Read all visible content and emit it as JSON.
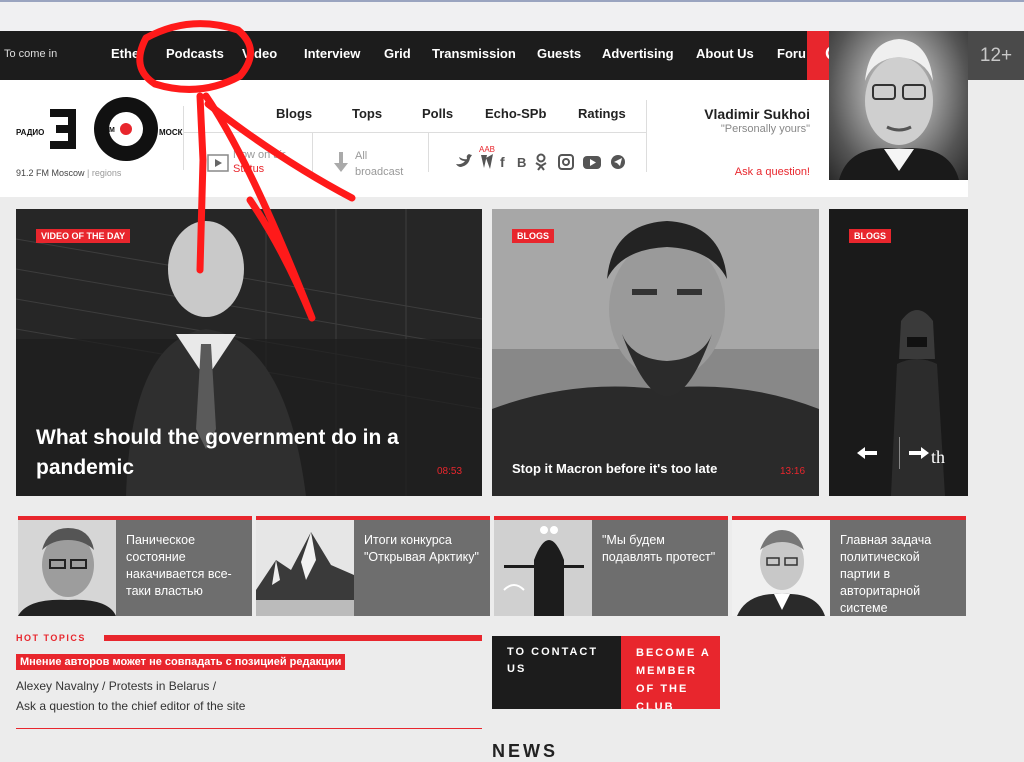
{
  "topnav": {
    "login": "To come in",
    "items": [
      "Ethe",
      "Podcasts",
      "Video",
      "Interview",
      "Grid",
      "Transmission",
      "Guests",
      "Advertising",
      "About Us",
      "Foru"
    ],
    "search_icon": "search-icon",
    "age_badge": "12+"
  },
  "header": {
    "logo": {
      "left": "РАДИО",
      "right": "МОСКВЫ",
      "alt": "Echo of Moscow"
    },
    "frequency": "91.2 FM Moscow",
    "regions": "regions",
    "secnav": [
      "Blogs",
      "Tops",
      "Polls",
      "Echo-SPb",
      "Ratings"
    ],
    "on_air": {
      "label": "Now on air",
      "status": "Status"
    },
    "all_broadcast": {
      "line1": "All",
      "line2": "broadcast"
    },
    "aab": "AAB",
    "social_icons": [
      "twitter-icon",
      "vk-icon",
      "facebook-icon",
      "b-icon",
      "odnoklassniki-icon",
      "instagram-icon",
      "youtube-icon",
      "telegram-icon"
    ],
    "author": {
      "name": "Vladimir Sukhoi",
      "column": "\"Personally yours\"",
      "ask": "Ask a question!"
    }
  },
  "featured": [
    {
      "tag": "VIDEO OF THE DAY",
      "title": "What should the government do in a pandemic",
      "time": "08:53"
    },
    {
      "tag": "BLOGS",
      "title": "Stop it Macron before it's too late",
      "time": "13:16"
    },
    {
      "tag": "BLOGS",
      "title": "",
      "arrows": "th"
    }
  ],
  "small_cards": [
    {
      "text": "Паническое состояние накачивается все-таки властью"
    },
    {
      "text": "Итоги конкурса \"Открывая Арктику\""
    },
    {
      "text": "\"Мы будем подавлять протест\""
    },
    {
      "text": "Главная задача политической партии в авторитарной системе"
    }
  ],
  "hot_topics": {
    "label": "HOT TOPICS",
    "disclaimer": "Мнение авторов может не совпадать с позицией редакции",
    "links_line1": "Alexey Navalny / Protests in Belarus /",
    "links_line2": "Ask a question to the chief editor of the site"
  },
  "contact": "TO CONTACT US",
  "member": "BECOME A MEMBER OF THE CLUB",
  "news_heading": "NEWS",
  "colors": {
    "accent": "#e8262d",
    "dark": "#1c1c1c",
    "annotation": "#ff1a1a"
  }
}
